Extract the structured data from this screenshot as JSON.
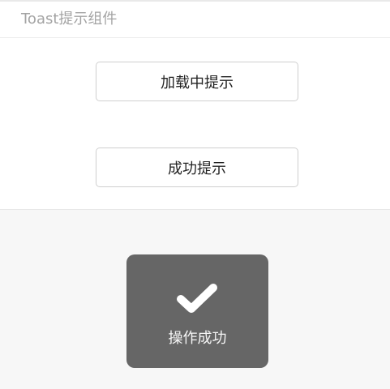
{
  "header": {
    "title": "Toast提示组件"
  },
  "buttons": {
    "loading_label": "加载中提示",
    "success_label": "成功提示"
  },
  "toast": {
    "icon": "checkmark-icon",
    "message": "操作成功"
  },
  "colors": {
    "toast_background": "#666666",
    "page_background": "#f7f7f7",
    "title_color": "#a3a3a3"
  }
}
